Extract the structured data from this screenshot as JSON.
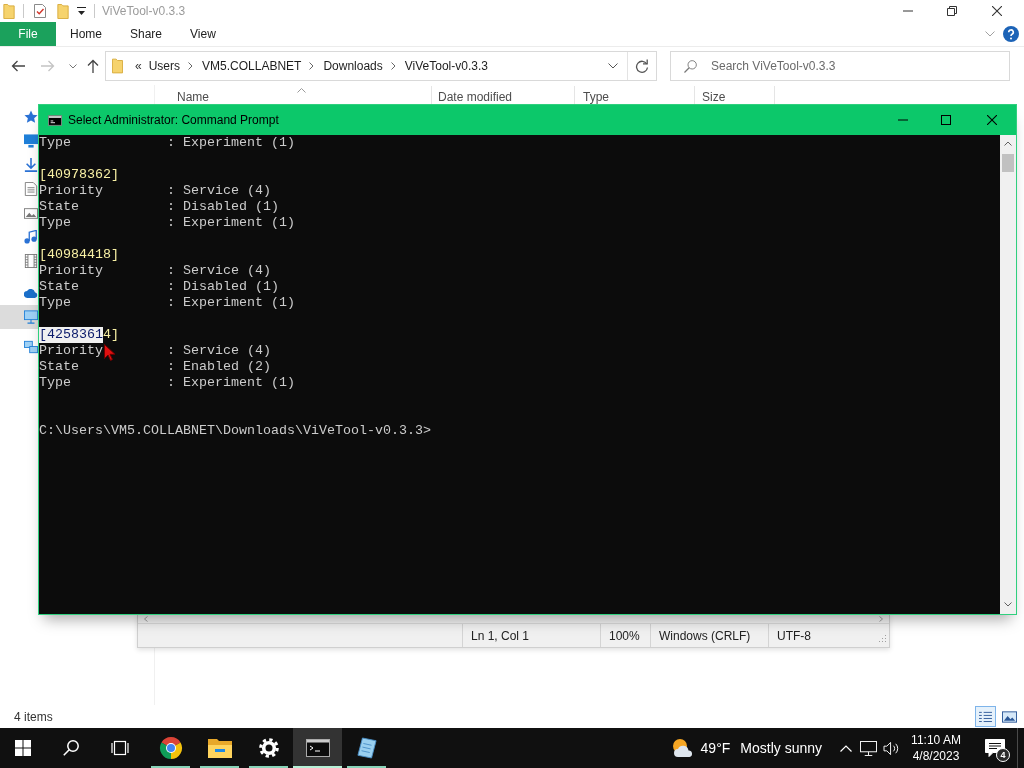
{
  "explorer": {
    "title": "ViVeTool-v0.3.3",
    "ribbon_tabs": [
      {
        "label": "File",
        "kind": "file",
        "selected": false
      },
      {
        "label": "Home",
        "kind": "tab",
        "selected": false
      },
      {
        "label": "Share",
        "kind": "tab",
        "selected": false
      },
      {
        "label": "View",
        "kind": "tab",
        "selected": false
      }
    ],
    "nav_buttons": [
      {
        "kind": "back",
        "disabled": false
      },
      {
        "kind": "forward",
        "disabled": true
      },
      {
        "kind": "recent",
        "disabled": false
      },
      {
        "kind": "up",
        "disabled": false
      }
    ],
    "address": {
      "overflow": "«",
      "segments": [
        "Users",
        "VM5.COLLABNET",
        "Downloads",
        "ViVeTool-v0.3.3"
      ]
    },
    "search": {
      "placeholder": "Search ViVeTool-v0.3.3"
    },
    "nav_items": [
      {
        "kind": "star",
        "selected": false
      },
      {
        "kind": "desktop",
        "selected": false
      },
      {
        "kind": "download",
        "selected": false
      },
      {
        "kind": "document",
        "selected": false
      },
      {
        "kind": "picture",
        "selected": false
      },
      {
        "kind": "music",
        "selected": false
      },
      {
        "kind": "video",
        "selected": false
      },
      {
        "kind": "cloud",
        "selected": false
      },
      {
        "kind": "computer",
        "selected": true
      },
      {
        "kind": "network",
        "selected": false
      }
    ],
    "columns": [
      {
        "label": "Name",
        "sorted": true
      },
      {
        "label": "Date modified",
        "sorted": false
      },
      {
        "label": "Type",
        "sorted": false
      },
      {
        "label": "Size",
        "sorted": false
      }
    ],
    "status": "4 items",
    "views": [
      {
        "kind": "details",
        "selected": true
      },
      {
        "kind": "large_icons",
        "selected": false
      }
    ]
  },
  "notepad": {
    "status_fields": [
      "Ln 1, Col 1",
      "100%",
      "Windows (CRLF)",
      "UTF-8"
    ]
  },
  "cmd": {
    "title": "Select Administrator: Command Prompt",
    "blocks": [
      {
        "lines": [
          {
            "key": "Type",
            "value": ": Experiment (1)"
          }
        ]
      },
      {
        "header": [
          {
            "text": "[40978362]",
            "selected": false
          }
        ],
        "lines": [
          {
            "key": "Priority",
            "value": ": Service (4)"
          },
          {
            "key": "State",
            "value": ": Disabled (1)"
          },
          {
            "key": "Type",
            "value": ": Experiment (1)"
          }
        ]
      },
      {
        "header": [
          {
            "text": "[40984418]",
            "selected": false
          }
        ],
        "lines": [
          {
            "key": "Priority",
            "value": ": Service (4)"
          },
          {
            "key": "State",
            "value": ": Disabled (1)"
          },
          {
            "key": "Type",
            "value": ": Experiment (1)"
          }
        ]
      },
      {
        "header": [
          {
            "text": "[4258361",
            "selected": true
          },
          {
            "text": "4]",
            "selected": false
          }
        ],
        "lines": [
          {
            "key": "Priority",
            "value": ": Service (4)"
          },
          {
            "key": "State",
            "value": ": Enabled (2)"
          },
          {
            "key": "Type",
            "value": ": Experiment (1)"
          }
        ]
      }
    ],
    "prompt": "C:\\Users\\VM5.COLLABNET\\Downloads\\ViVeTool-v0.3.3>"
  },
  "taskbar": {
    "apps": [
      {
        "kind": "browser",
        "running": true,
        "selected": false
      },
      {
        "kind": "file_explorer",
        "running": true,
        "selected": false
      },
      {
        "kind": "settings",
        "running": true,
        "selected": false
      },
      {
        "kind": "terminal",
        "running": true,
        "selected": true
      },
      {
        "kind": "notepad",
        "running": true,
        "selected": false
      }
    ],
    "weather": {
      "temperature": "49°F",
      "condition": "Mostly sunny"
    },
    "clock": {
      "time": "11:10 AM",
      "date": "4/8/2023"
    },
    "notification_count": "4"
  }
}
